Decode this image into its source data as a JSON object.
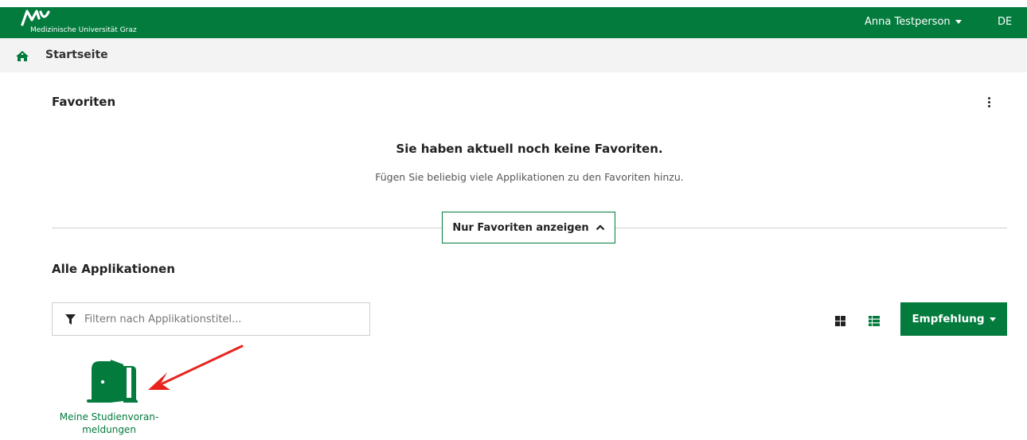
{
  "header": {
    "logo_text": "Medizinische Universität Graz",
    "user_name": "Anna Testperson",
    "language": "DE",
    "brand_color": "#027b3d"
  },
  "breadcrumb": {
    "home_icon": "home-icon",
    "current": "Startseite"
  },
  "favorites": {
    "title": "Favoriten",
    "menu_icon": "kebab-menu-icon",
    "empty_title": "Sie haben aktuell noch keine Favoriten.",
    "empty_subtitle": "Fügen Sie beliebig viele Applikationen zu den Favoriten hinzu.",
    "toggle_label": "Nur Favoriten anzeigen"
  },
  "applications": {
    "title": "Alle Applikationen",
    "filter_placeholder": "Filtern nach Applikationstitel...",
    "filter_icon": "filter-icon",
    "view_icons": [
      "grid-view-icon",
      "list-view-icon"
    ],
    "sort_button": "Empfehlung",
    "items": [
      {
        "icon": "door-icon",
        "label_line1": "Meine Studienvoran-",
        "label_line2": "meldungen"
      }
    ]
  },
  "annotation": {
    "arrow_color": "#e8241e"
  }
}
